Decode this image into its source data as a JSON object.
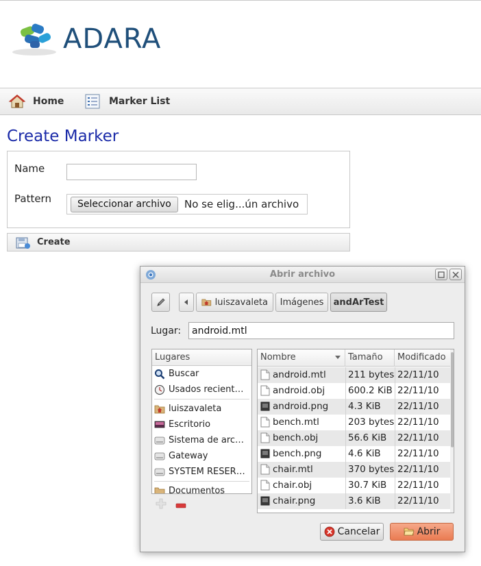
{
  "brand": {
    "name": "ADARA"
  },
  "nav": [
    {
      "label": "Home",
      "icon": "home-icon"
    },
    {
      "label": "Marker List",
      "icon": "list-icon"
    }
  ],
  "form": {
    "title": "Create Marker",
    "name_label": "Name",
    "name_value": "",
    "pattern_label": "Pattern",
    "file_button": "Seleccionar archivo",
    "file_status": "No se elig...ún archivo",
    "create_label": "Create"
  },
  "dialog": {
    "title": "Abrir archivo",
    "path": [
      "luiszavaleta",
      "Imágenes",
      "andArTest"
    ],
    "location_label": "Lugar:",
    "location_value": "android.mtl",
    "places_header": "Lugares",
    "places": [
      {
        "label": "Buscar",
        "icon": "search-icon"
      },
      {
        "label": "Usados recient…",
        "icon": "recent-icon"
      },
      {
        "label": "luiszavaleta",
        "icon": "home-folder-icon"
      },
      {
        "label": "Escritorio",
        "icon": "desktop-icon"
      },
      {
        "label": "Sistema de arc…",
        "icon": "drive-icon"
      },
      {
        "label": "Gateway",
        "icon": "drive-icon"
      },
      {
        "label": "SYSTEM RESER…",
        "icon": "drive-icon"
      },
      {
        "label": "Documentos",
        "icon": "folder-icon"
      }
    ],
    "columns": {
      "name": "Nombre",
      "size": "Tamaño",
      "date": "Modificado"
    },
    "files": [
      {
        "name": "android.mtl",
        "size": "211 bytes",
        "date": "22/11/10",
        "kind": "doc"
      },
      {
        "name": "android.obj",
        "size": "600.2 KiB",
        "date": "22/11/10",
        "kind": "doc"
      },
      {
        "name": "android.png",
        "size": "4.3 KiB",
        "date": "22/11/10",
        "kind": "image"
      },
      {
        "name": "bench.mtl",
        "size": "203 bytes",
        "date": "22/11/10",
        "kind": "doc"
      },
      {
        "name": "bench.obj",
        "size": "56.6 KiB",
        "date": "22/11/10",
        "kind": "doc"
      },
      {
        "name": "bench.png",
        "size": "4.6 KiB",
        "date": "22/11/10",
        "kind": "image"
      },
      {
        "name": "chair.mtl",
        "size": "370 bytes",
        "date": "22/11/10",
        "kind": "doc"
      },
      {
        "name": "chair.obj",
        "size": "30.7 KiB",
        "date": "22/11/10",
        "kind": "doc"
      },
      {
        "name": "chair.png",
        "size": "3.6 KiB",
        "date": "22/11/10",
        "kind": "image"
      }
    ],
    "cancel_label": "Cancelar",
    "open_label": "Abrir"
  },
  "colors": {
    "accent": "#1a2aa8",
    "logo_blue": "#1f4f7a",
    "open_button": "#ea7b52"
  }
}
